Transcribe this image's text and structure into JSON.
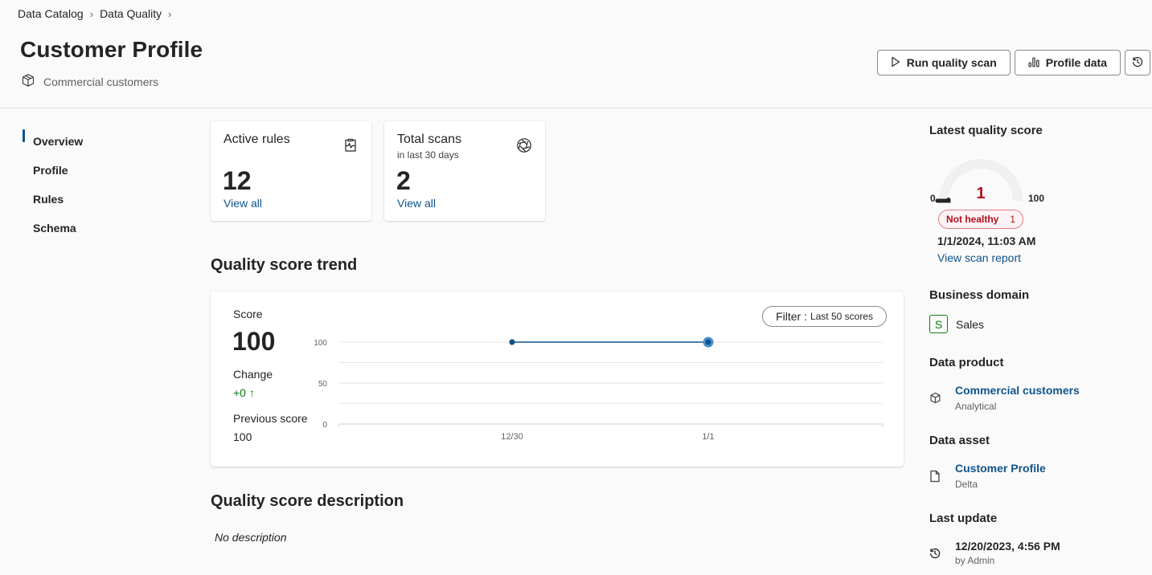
{
  "breadcrumb": [
    {
      "label": "Data Catalog"
    },
    {
      "label": "Data Quality"
    }
  ],
  "header": {
    "title": "Customer Profile",
    "subtitle": "Commercial customers",
    "subtitle_icon": "cube-icon",
    "actions": {
      "run_scan": "Run quality scan",
      "profile": "Profile data",
      "history_icon": "history-icon"
    }
  },
  "nav": {
    "items": [
      {
        "label": "Overview",
        "active": true
      },
      {
        "label": "Profile",
        "active": false
      },
      {
        "label": "Rules",
        "active": false
      },
      {
        "label": "Schema",
        "active": false
      }
    ]
  },
  "cards": {
    "active_rules": {
      "title": "Active rules",
      "value": "12",
      "link": "View all",
      "icon": "rules-health-icon"
    },
    "total_scans": {
      "title": "Total scans",
      "subtitle": "in last 30 days",
      "value": "2",
      "link": "View all",
      "icon": "aperture-icon"
    }
  },
  "trend": {
    "section_title": "Quality score trend",
    "score_label": "Score",
    "score_value": "100",
    "change_label": "Change",
    "change_value": "+0 ↑",
    "previous_label": "Previous score",
    "previous_value": "100",
    "filter_label": "Filter :",
    "filter_value": "Last 50 scores"
  },
  "chart_data": {
    "type": "line",
    "title": "",
    "xlabel": "",
    "ylabel": "",
    "categories": [
      "12/30",
      "1/1"
    ],
    "series": [
      {
        "name": "Score",
        "values": [
          100,
          100
        ]
      }
    ],
    "yticks": [
      0,
      50,
      100
    ],
    "ylim": [
      0,
      100
    ],
    "grid": true,
    "legend": "none",
    "colors": {
      "line": "#0f548c",
      "highlight": "#4a8fcb",
      "grid": "#e6e6e6",
      "axis": "#c7d4e2"
    }
  },
  "description": {
    "section_title": "Quality score description",
    "text": "No description"
  },
  "right_panel": {
    "latest": {
      "heading": "Latest quality score",
      "score": "1",
      "min_label": "0",
      "max_label": "100",
      "gauge_fraction": 0.01,
      "status": "Not healthy",
      "status_count": "1",
      "date": "1/1/2024, 11:03 AM",
      "report_link": "View scan report"
    },
    "business_domain": {
      "heading": "Business domain",
      "initial": "S",
      "name": "Sales"
    },
    "data_product": {
      "heading": "Data product",
      "name": "Commercial customers",
      "type": "Analytical",
      "icon": "cube-icon"
    },
    "data_asset": {
      "heading": "Data asset",
      "name": "Customer Profile",
      "type": "Delta",
      "icon": "document-icon"
    },
    "last_update": {
      "heading": "Last update",
      "date": "12/20/2023, 4:56 PM",
      "by": "by Admin",
      "icon": "history-icon"
    }
  },
  "colors": {
    "accent": "#0f548c",
    "success": "#107c10",
    "danger": "#b10e1c",
    "danger_bg": "#fdf3f4"
  }
}
